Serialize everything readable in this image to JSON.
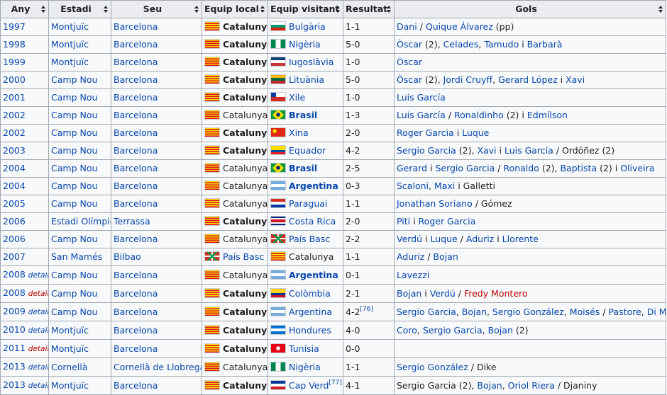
{
  "headers": [
    "Any",
    "Estadi",
    "Seu",
    "Equip local",
    "Equip visitant",
    "Resultat",
    "Gols"
  ],
  "flags": {
    "cat": "#fcdd09|#da121a",
    "bul": "#ffffff|#00966e|#d62612",
    "nga": "#008751|#ffffff|#008751",
    "yug": "#0c4076|#ffffff|#c6363c",
    "ltu": "#fdb913|#006a44|#c1272d",
    "chi": "#ffffff|#d52b1e",
    "bra": "#009c3b|#ffdf00|#002776",
    "chn": "#de2910|#ffde00",
    "ecu": "#ffdd00|#034ea2|#ed1c24",
    "arg": "#74acdf|#ffffff|#74acdf",
    "par": "#d52b1e|#ffffff|#0038a8",
    "crc": "#002b7f|#ffffff|#ce1126",
    "eus": "#d52b1e|#009b48|#ffffff",
    "col": "#fcd116|#003893|#ce1126",
    "hon": "#0073cf|#ffffff|#0073cf",
    "tun": "#e70013|#ffffff",
    "cpv": "#003893|#ffffff|#cf2027"
  },
  "rows": [
    {
      "any": "1997",
      "det": "",
      "estadi": "Montjuïc",
      "seu": "Barcelona",
      "local": "Catalunya",
      "lflag": "cat",
      "lbold": true,
      "visit": "Bulgària",
      "vflag": "bul",
      "vbold": false,
      "result": "1-1",
      "sup": "",
      "gols": [
        [
          "Dani",
          "l"
        ],
        [
          " / ",
          "t"
        ],
        [
          "Quique Álvarez",
          "l"
        ],
        [
          " (pp)",
          "t"
        ]
      ]
    },
    {
      "any": "1998",
      "det": "",
      "estadi": "Montjuïc",
      "seu": "Barcelona",
      "local": "Catalunya",
      "lflag": "cat",
      "lbold": true,
      "visit": "Nigèria",
      "vflag": "nga",
      "vbold": false,
      "result": "5-0",
      "sup": "",
      "gols": [
        [
          "Òscar",
          "l"
        ],
        [
          " (2), ",
          "t"
        ],
        [
          "Celades",
          "l"
        ],
        [
          ", ",
          "t"
        ],
        [
          "Tamudo",
          "l"
        ],
        [
          " i ",
          "t"
        ],
        [
          "Barbarà",
          "l"
        ]
      ]
    },
    {
      "any": "1999",
      "det": "",
      "estadi": "Montjuïc",
      "seu": "Barcelona",
      "local": "Catalunya",
      "lflag": "cat",
      "lbold": true,
      "visit": "Iugoslàvia",
      "vflag": "yug",
      "vbold": false,
      "result": "1-0",
      "sup": "",
      "gols": [
        [
          "Òscar",
          "l"
        ]
      ]
    },
    {
      "any": "2000",
      "det": "",
      "estadi": "Camp Nou",
      "seu": "Barcelona",
      "local": "Catalunya",
      "lflag": "cat",
      "lbold": true,
      "visit": "Lituània",
      "vflag": "ltu",
      "vbold": false,
      "result": "5-0",
      "sup": "",
      "gols": [
        [
          "Òscar",
          "l"
        ],
        [
          " (2), ",
          "t"
        ],
        [
          "Jordi Cruyff",
          "l"
        ],
        [
          ", ",
          "t"
        ],
        [
          "Gerard López",
          "l"
        ],
        [
          " i ",
          "t"
        ],
        [
          "Xavi",
          "l"
        ]
      ]
    },
    {
      "any": "2001",
      "det": "",
      "estadi": "Camp Nou",
      "seu": "Barcelona",
      "local": "Catalunya",
      "lflag": "cat",
      "lbold": true,
      "visit": "Xile",
      "vflag": "chi",
      "vbold": false,
      "result": "1-0",
      "sup": "",
      "gols": [
        [
          "Luis García",
          "l"
        ]
      ]
    },
    {
      "any": "2002",
      "det": "",
      "estadi": "Camp Nou",
      "seu": "Barcelona",
      "local": "Catalunya",
      "lflag": "cat",
      "lbold": false,
      "visit": "Brasil",
      "vflag": "bra",
      "vbold": true,
      "result": "1-3",
      "sup": "",
      "gols": [
        [
          "Luis García",
          "l"
        ],
        [
          " / ",
          "t"
        ],
        [
          "Ronaldinho",
          "l"
        ],
        [
          " (2) i ",
          "t"
        ],
        [
          "Edmílson",
          "l"
        ]
      ]
    },
    {
      "any": "2002",
      "det": "",
      "estadi": "Camp Nou",
      "seu": "Barcelona",
      "local": "Catalunya",
      "lflag": "cat",
      "lbold": true,
      "visit": "Xina",
      "vflag": "chn",
      "vbold": false,
      "result": "2-0",
      "sup": "",
      "gols": [
        [
          "Roger Garcia",
          "l"
        ],
        [
          " i ",
          "t"
        ],
        [
          "Luque",
          "l"
        ]
      ]
    },
    {
      "any": "2003",
      "det": "",
      "estadi": "Camp Nou",
      "seu": "Barcelona",
      "local": "Catalunya",
      "lflag": "cat",
      "lbold": true,
      "visit": "Equador",
      "vflag": "ecu",
      "vbold": false,
      "result": "4-2",
      "sup": "",
      "gols": [
        [
          "Sergio Garcia",
          "l"
        ],
        [
          " (2), ",
          "t"
        ],
        [
          "Xavi",
          "l"
        ],
        [
          " i ",
          "t"
        ],
        [
          "Luis García",
          "l"
        ],
        [
          " / Ordóñez (2)",
          "t"
        ]
      ]
    },
    {
      "any": "2004",
      "det": "",
      "estadi": "Camp Nou",
      "seu": "Barcelona",
      "local": "Catalunya",
      "lflag": "cat",
      "lbold": false,
      "visit": "Brasil",
      "vflag": "bra",
      "vbold": true,
      "result": "2-5",
      "sup": "",
      "gols": [
        [
          "Gerard",
          "l"
        ],
        [
          " i ",
          "t"
        ],
        [
          "Sergio Garcia",
          "l"
        ],
        [
          " / ",
          "t"
        ],
        [
          "Ronaldo",
          "l"
        ],
        [
          " (2), ",
          "t"
        ],
        [
          "Baptista",
          "l"
        ],
        [
          " (2) i ",
          "t"
        ],
        [
          "Oliveira",
          "l"
        ]
      ]
    },
    {
      "any": "2004",
      "det": "",
      "estadi": "Camp Nou",
      "seu": "Barcelona",
      "local": "Catalunya",
      "lflag": "cat",
      "lbold": false,
      "visit": "Argentina",
      "vflag": "arg",
      "vbold": true,
      "result": "0-3",
      "sup": "",
      "gols": [
        [
          "Scaloni",
          "l"
        ],
        [
          ", ",
          "t"
        ],
        [
          "Maxi",
          "l"
        ],
        [
          " i Galletti",
          "t"
        ]
      ]
    },
    {
      "any": "2005",
      "det": "",
      "estadi": "Camp Nou",
      "seu": "Barcelona",
      "local": "Catalunya",
      "lflag": "cat",
      "lbold": false,
      "visit": "Paraguai",
      "vflag": "par",
      "vbold": false,
      "result": "1-1",
      "sup": "",
      "gols": [
        [
          "Jonathan Soriano",
          "l"
        ],
        [
          " / Gómez",
          "t"
        ]
      ]
    },
    {
      "any": "2006",
      "det": "",
      "estadi": "Estadi Olímpic",
      "seu": "Terrassa",
      "local": "Catalunya",
      "lflag": "cat",
      "lbold": true,
      "visit": "Costa Rica",
      "vflag": "crc",
      "vbold": false,
      "result": "2-0",
      "sup": "",
      "gols": [
        [
          "Piti",
          "l"
        ],
        [
          " i ",
          "t"
        ],
        [
          "Roger Garcia",
          "l"
        ]
      ]
    },
    {
      "any": "2006",
      "det": "",
      "estadi": "Camp Nou",
      "seu": "Barcelona",
      "local": "Catalunya",
      "lflag": "cat",
      "lbold": false,
      "visit": "País Basc",
      "vflag": "eus",
      "vbold": false,
      "result": "2-2",
      "sup": "",
      "gols": [
        [
          "Verdú",
          "l"
        ],
        [
          " i ",
          "t"
        ],
        [
          "Luque",
          "l"
        ],
        [
          " / ",
          "t"
        ],
        [
          "Aduriz",
          "l"
        ],
        [
          " i ",
          "t"
        ],
        [
          "Llorente",
          "l"
        ]
      ]
    },
    {
      "any": "2007",
      "det": "",
      "estadi": "San Mamés",
      "seu": "Bilbao",
      "local": "País Basc",
      "lflag": "eus",
      "lbold": false,
      "llink": true,
      "visit": "Catalunya",
      "vflag": "cat",
      "vbold": false,
      "vplain": true,
      "result": "1-1",
      "sup": "",
      "gols": [
        [
          "Aduriz",
          "l"
        ],
        [
          " / ",
          "t"
        ],
        [
          "Bojan",
          "l"
        ]
      ]
    },
    {
      "any": "2008",
      "det": "details",
      "detred": false,
      "estadi": "Camp Nou",
      "seu": "Barcelona",
      "local": "Catalunya",
      "lflag": "cat",
      "lbold": false,
      "visit": "Argentina",
      "vflag": "arg",
      "vbold": true,
      "result": "0-1",
      "sup": "",
      "gols": [
        [
          "Lavezzi",
          "l"
        ]
      ]
    },
    {
      "any": "2008",
      "det": "details",
      "detred": true,
      "estadi": "Camp Nou",
      "seu": "Barcelona",
      "local": "Catalunya",
      "lflag": "cat",
      "lbold": true,
      "visit": "Colòmbia",
      "vflag": "col",
      "vbold": false,
      "result": "2-1",
      "sup": "",
      "gols": [
        [
          "Bojan",
          "l"
        ],
        [
          " i ",
          "t"
        ],
        [
          "Verdú",
          "l"
        ],
        [
          " / ",
          "t"
        ],
        [
          "Fredy Montero",
          "r"
        ]
      ]
    },
    {
      "any": "2009",
      "det": "details",
      "detred": false,
      "estadi": "Camp Nou",
      "seu": "Barcelona",
      "local": "Catalunya",
      "lflag": "cat",
      "lbold": true,
      "visit": "Argentina",
      "vflag": "arg",
      "vbold": false,
      "result": "4-2",
      "sup": "[76]",
      "gols": [
        [
          "Sergio Garcia",
          "l"
        ],
        [
          ", ",
          "t"
        ],
        [
          "Bojan",
          "l"
        ],
        [
          ", ",
          "t"
        ],
        [
          "Sergio González",
          "l"
        ],
        [
          ", ",
          "t"
        ],
        [
          "Moisés",
          "l"
        ],
        [
          " / ",
          "t"
        ],
        [
          "Pastore",
          "l"
        ],
        [
          ", ",
          "t"
        ],
        [
          "Di María",
          "l"
        ]
      ]
    },
    {
      "any": "2010",
      "det": "details",
      "detred": false,
      "estadi": "Montjuïc",
      "seu": "Barcelona",
      "local": "Catalunya",
      "lflag": "cat",
      "lbold": true,
      "visit": "Hondures",
      "vflag": "hon",
      "vbold": false,
      "result": "4-0",
      "sup": "",
      "gols": [
        [
          "Coro",
          "l"
        ],
        [
          ", ",
          "t"
        ],
        [
          "Sergio Garcia",
          "l"
        ],
        [
          ", ",
          "t"
        ],
        [
          "Bojan",
          "l"
        ],
        [
          " (2)",
          "t"
        ]
      ]
    },
    {
      "any": "2011",
      "det": "details",
      "detred": true,
      "estadi": "Montjuïc",
      "seu": "Barcelona",
      "local": "Catalunya",
      "lflag": "cat",
      "lbold": true,
      "visit": "Tunísia",
      "vflag": "tun",
      "vbold": false,
      "result": "0-0",
      "sup": "",
      "gols": []
    },
    {
      "any": "2013",
      "det": "details",
      "detred": false,
      "estadi": "Cornellà",
      "seu": "Cornellà de Llobregat",
      "local": "Catalunya",
      "lflag": "cat",
      "lbold": false,
      "visit": "Nigèria",
      "vflag": "nga",
      "vbold": false,
      "result": "1-1",
      "sup": "",
      "gols": [
        [
          "Sergio González",
          "l"
        ],
        [
          " / Dike",
          "t"
        ]
      ]
    },
    {
      "any": "2013",
      "det": "details",
      "detred": false,
      "estadi": "Montjuïc",
      "seu": "Barcelona",
      "local": "Catalunya",
      "lflag": "cat",
      "lbold": true,
      "visit": "Cap Verd",
      "vflag": "cpv",
      "vbold": false,
      "result": "4-1",
      "sup": "",
      "vsup": "[77]",
      "gols": [
        [
          "Sergio Garcia (2), ",
          "t"
        ],
        [
          "Bojan",
          "l"
        ],
        [
          ", ",
          "t"
        ],
        [
          "Oriol Riera",
          "l"
        ],
        [
          " / Djaniny",
          "t"
        ]
      ]
    }
  ]
}
